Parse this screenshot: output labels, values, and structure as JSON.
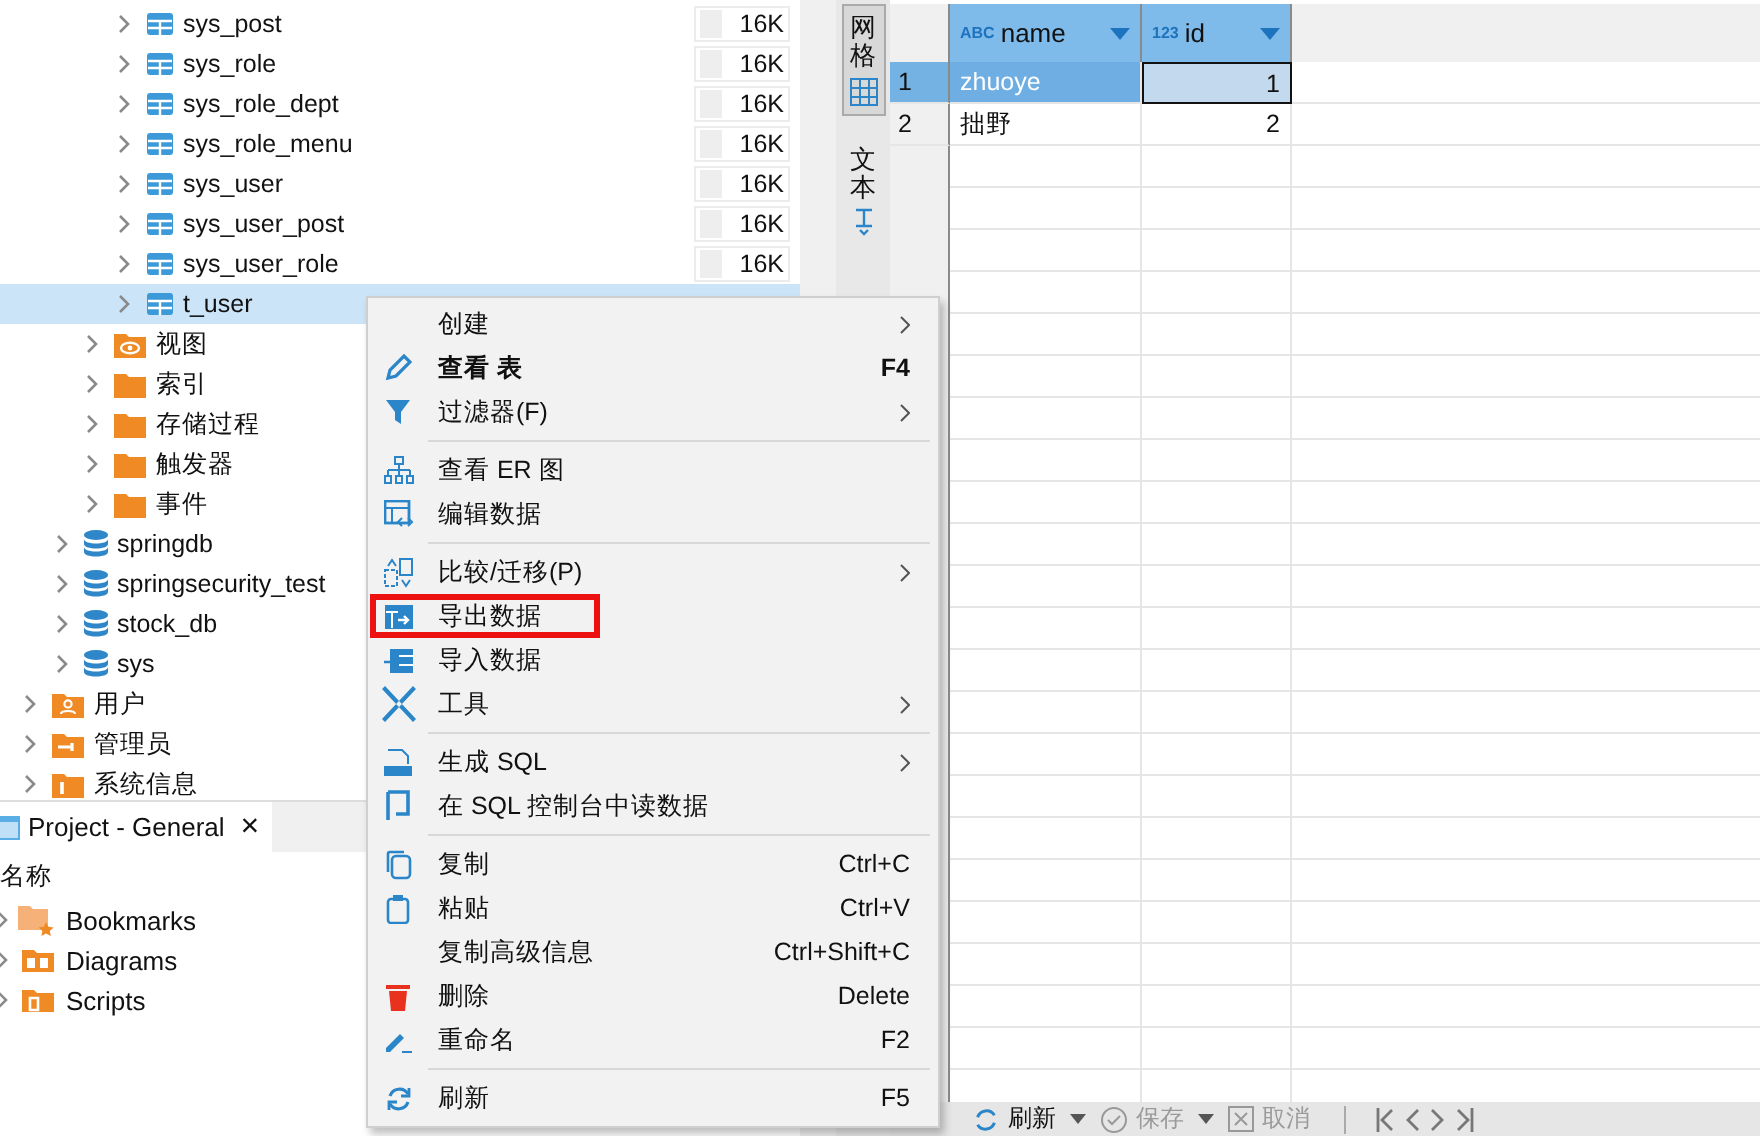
{
  "tree": [
    {
      "children": [
        {
          "children": [
            {
              "children": [
                {
                  "label": "sys_post",
                  "kind": "table",
                  "size": "16K",
                  "selected": false
                },
                {
                  "label": "sys_role",
                  "kind": "table",
                  "size": "16K",
                  "selected": false
                },
                {
                  "label": "sys_role_dept",
                  "kind": "table",
                  "size": "16K",
                  "selected": false
                },
                {
                  "label": "sys_role_menu",
                  "kind": "table",
                  "size": "16K",
                  "selected": false
                },
                {
                  "label": "sys_user",
                  "kind": "table",
                  "size": "16K",
                  "selected": false
                },
                {
                  "label": "sys_user_post",
                  "kind": "table",
                  "size": "16K",
                  "selected": false
                },
                {
                  "label": "sys_user_role",
                  "kind": "table",
                  "size": "16K",
                  "selected": false
                },
                {
                  "label": "t_user",
                  "kind": "table",
                  "selected": true
                }
              ]
            },
            {
              "label": "视图",
              "kind": "view-folder",
              "selected": false
            },
            {
              "label": "索引",
              "kind": "folder",
              "selected": false
            },
            {
              "label": "存储过程",
              "kind": "folder",
              "selected": false
            },
            {
              "label": "触发器",
              "kind": "folder",
              "selected": false
            },
            {
              "label": "事件",
              "kind": "folder",
              "selected": false
            }
          ]
        },
        {
          "label": "springdb",
          "kind": "database",
          "selected": false
        },
        {
          "label": "springsecurity_test",
          "kind": "database",
          "selected": false
        },
        {
          "label": "stock_db",
          "kind": "database",
          "selected": false
        },
        {
          "label": "sys",
          "kind": "database",
          "selected": false
        }
      ]
    },
    {
      "label": "用户",
      "kind": "users",
      "selected": false
    },
    {
      "label": "管理员",
      "kind": "admins",
      "selected": false
    },
    {
      "label": "系统信息",
      "kind": "info",
      "selected": false
    }
  ],
  "project": {
    "tab": "Project - General",
    "close": "×",
    "header": "名称",
    "items": [
      {
        "label": "Bookmarks",
        "kind": "bookmarks"
      },
      {
        "label": "Diagrams",
        "kind": "diagrams"
      },
      {
        "label": "Scripts",
        "kind": "scripts"
      }
    ]
  },
  "view_tabs": [
    {
      "label": "网格",
      "kind": "grid",
      "selected": true
    },
    {
      "label": "文本",
      "kind": "text",
      "selected": false
    }
  ],
  "table": {
    "columns": [
      {
        "label": "name",
        "kind": "text",
        "type_tag": "ABC"
      },
      {
        "label": "id",
        "kind": "number",
        "type_tag": "123"
      }
    ],
    "rows": [
      {
        "number": "1",
        "cells": [
          "zhuoye",
          "1"
        ],
        "selected": true
      },
      {
        "number": "2",
        "cells": [
          "拙野",
          "2"
        ],
        "selected": false
      }
    ]
  },
  "toolbar": [
    {
      "label": "刷新",
      "kind": "refresh",
      "disabled": false
    },
    {
      "label": "保存",
      "kind": "save",
      "disabled": true
    },
    {
      "label": "取消",
      "kind": "cancel",
      "disabled": true
    }
  ],
  "context_menu": [
    {
      "kind": "item",
      "label": "创建",
      "submenu": true,
      "bold": false,
      "highlighted": false
    },
    {
      "kind": "item",
      "label": "查看 表",
      "shortcut": "F4",
      "submenu": false,
      "bold": true,
      "highlighted": false
    },
    {
      "kind": "item",
      "label": "过滤器(F)",
      "submenu": true,
      "bold": false,
      "highlighted": false
    },
    {
      "kind": "separator"
    },
    {
      "kind": "item",
      "label": "查看 ER 图",
      "submenu": false,
      "bold": false,
      "highlighted": false
    },
    {
      "kind": "item",
      "label": "编辑数据",
      "submenu": false,
      "bold": false,
      "highlighted": false
    },
    {
      "kind": "separator"
    },
    {
      "kind": "item",
      "label": "比较/迁移(P)",
      "submenu": true,
      "bold": false,
      "highlighted": false
    },
    {
      "kind": "item",
      "label": "导出数据",
      "submenu": false,
      "bold": false,
      "highlighted": true
    },
    {
      "kind": "item",
      "label": "导入数据",
      "submenu": false,
      "bold": false,
      "highlighted": false
    },
    {
      "kind": "item",
      "label": "工具",
      "submenu": true,
      "bold": false,
      "highlighted": false
    },
    {
      "kind": "separator"
    },
    {
      "kind": "item",
      "label": "生成 SQL",
      "submenu": true,
      "bold": false,
      "highlighted": false
    },
    {
      "kind": "item",
      "label": "在 SQL 控制台中读数据",
      "submenu": false,
      "bold": false,
      "highlighted": false
    },
    {
      "kind": "separator"
    },
    {
      "kind": "item",
      "label": "复制",
      "shortcut": "Ctrl+C",
      "submenu": false,
      "bold": false,
      "highlighted": false
    },
    {
      "kind": "item",
      "label": "粘贴",
      "shortcut": "Ctrl+V",
      "submenu": false,
      "bold": false,
      "highlighted": false
    },
    {
      "kind": "item",
      "label": "复制高级信息",
      "shortcut": "Ctrl+Shift+C",
      "submenu": false,
      "bold": false,
      "highlighted": false
    },
    {
      "kind": "item",
      "label": "删除",
      "shortcut": "Delete",
      "submenu": false,
      "bold": false,
      "highlighted": false
    },
    {
      "kind": "item",
      "label": "重命名",
      "shortcut": "F2",
      "submenu": false,
      "bold": false,
      "highlighted": false
    },
    {
      "kind": "separator"
    },
    {
      "kind": "item",
      "label": "刷新",
      "shortcut": "F5",
      "submenu": false,
      "bold": false,
      "highlighted": false
    }
  ]
}
